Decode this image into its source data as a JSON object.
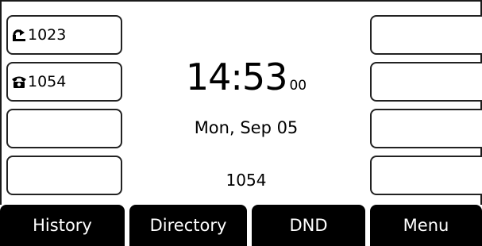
{
  "line_keys": {
    "left": [
      {
        "label": "1023",
        "icon": "call-forward-icon"
      },
      {
        "label": "1054",
        "icon": "phone-icon"
      },
      {
        "label": ""
      },
      {
        "label": ""
      }
    ],
    "right": [
      {
        "label": ""
      },
      {
        "label": ""
      },
      {
        "label": ""
      },
      {
        "label": ""
      }
    ]
  },
  "idle": {
    "time": "14:53",
    "seconds": "00",
    "date": "Mon, Sep 05",
    "account": "1054"
  },
  "softkeys": [
    "History",
    "Directory",
    "DND",
    "Menu"
  ]
}
